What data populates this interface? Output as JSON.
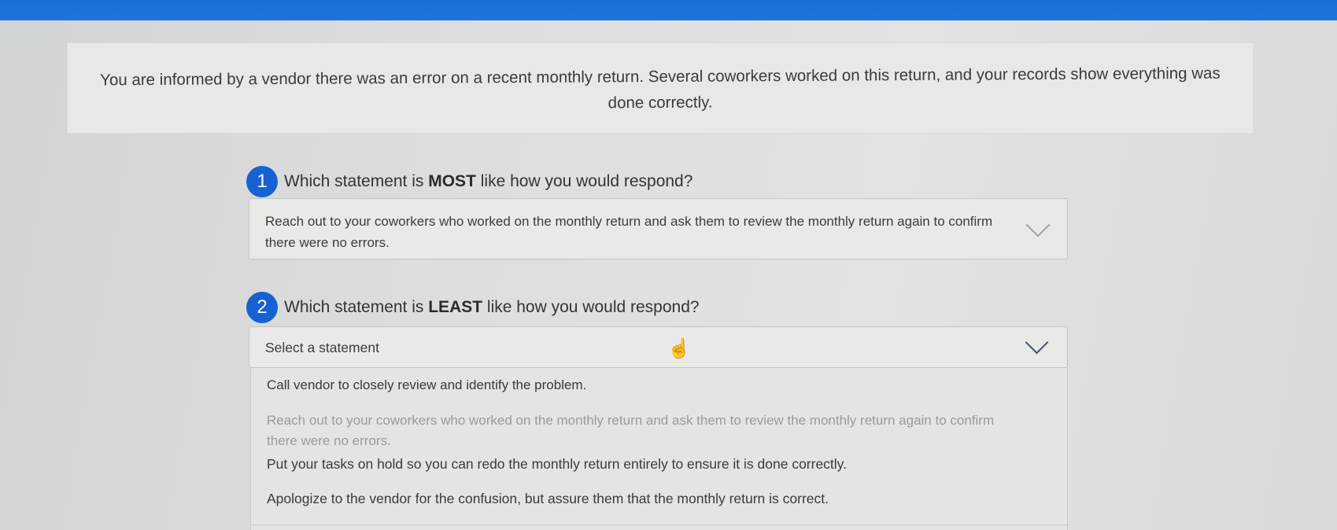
{
  "scenario": {
    "text": "You are informed by a vendor there was an error on a recent monthly return. Several coworkers worked on this return, and your records show everything was done correctly."
  },
  "questions": [
    {
      "number": "1",
      "prefix": "Which statement is ",
      "emphasis": "MOST",
      "suffix": " like how you would respond?",
      "selected_value": "Reach out to your coworkers who worked on the monthly return and ask them to review the monthly return again to confirm there were no errors."
    },
    {
      "number": "2",
      "prefix": "Which statement is ",
      "emphasis": "LEAST",
      "suffix": " like how you would respond?",
      "placeholder": "Select a statement",
      "options": [
        {
          "label": "Call vendor to closely review and identify the problem.",
          "disabled": false
        },
        {
          "label": "Reach out to your coworkers who worked on the monthly return and ask them to review the monthly return again to confirm there were no errors.",
          "disabled": true
        },
        {
          "label": "Put your tasks on hold so you can redo the monthly return entirely to ensure it is done correctly.",
          "disabled": false
        },
        {
          "label": "Apologize to the vendor for the confusion, but assure them that the monthly return is correct.",
          "disabled": false
        }
      ]
    }
  ],
  "icons": {
    "dropdown": "chevron-down-icon",
    "cursor": "hand-pointer-icon"
  },
  "colors": {
    "top_bar": "#1e74dc",
    "badge": "#1662d2",
    "disabled_option": "#9b9b9b"
  }
}
